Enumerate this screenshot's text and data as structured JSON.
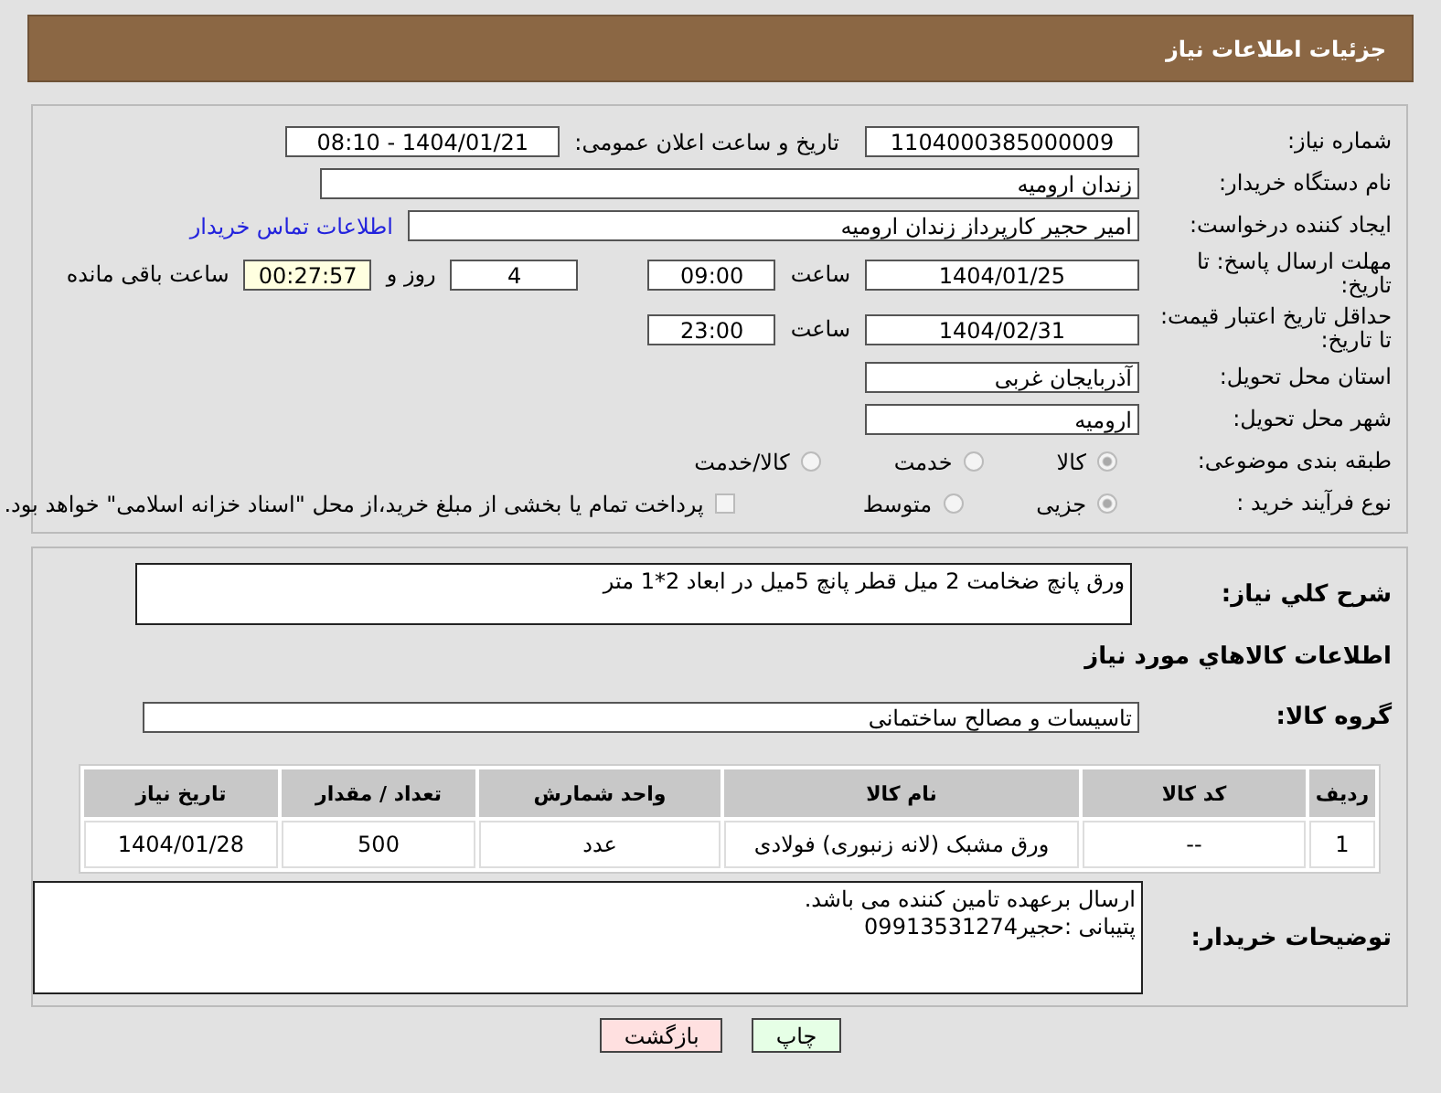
{
  "header": {
    "title": "جزئیات اطلاعات نیاز"
  },
  "need_number": {
    "label": "شماره نیاز:",
    "value": "1104000385000009"
  },
  "announce": {
    "label": "تاریخ و ساعت اعلان عمومی:",
    "value": "1404/01/21 - 08:10"
  },
  "buyer_org": {
    "label": "نام دستگاه خریدار:",
    "value": "زندان ارومیه"
  },
  "creator": {
    "label": "ایجاد کننده درخواست:",
    "value": "امیر حجیر کارپرداز زندان ارومیه",
    "link": "اطلاعات تماس خریدار"
  },
  "deadline": {
    "label": "مهلت ارسال پاسخ: تا تاریخ:",
    "date": "1404/01/25",
    "time_label": "ساعت",
    "time": "09:00",
    "days": "4",
    "days_label": "روز و",
    "remaining": "00:27:57",
    "remaining_label": "ساعت باقی مانده"
  },
  "validity": {
    "label": "حداقل تاریخ اعتبار قیمت: تا تاریخ:",
    "date": "1404/02/31",
    "time_label": "ساعت",
    "time": "23:00"
  },
  "province": {
    "label": "استان محل تحویل:",
    "value": "آذربایجان غربی"
  },
  "city": {
    "label": "شهر محل تحویل:",
    "value": "ارومیه"
  },
  "category": {
    "label": "طبقه بندی موضوعی:",
    "options": [
      {
        "label": "کالا",
        "selected": true
      },
      {
        "label": "خدمت",
        "selected": false
      },
      {
        "label": "کالا/خدمت",
        "selected": false
      }
    ]
  },
  "process": {
    "label": "نوع فرآیند خرید :",
    "options": [
      {
        "label": "جزیی",
        "selected": true
      },
      {
        "label": "متوسط",
        "selected": false
      }
    ],
    "payment": {
      "label": "پرداخت تمام یا بخشی از مبلغ خرید،از محل \"اسناد خزانه اسلامی\" خواهد بود.",
      "checked": false
    }
  },
  "description": {
    "label": "شرح کلي نیاز:",
    "value": "ورق پانچ ضخامت 2 میل قطر پانچ 5میل در ابعاد 2*1 متر"
  },
  "goods_heading": "اطلاعات کالاهاي مورد نیاز",
  "goods_group": {
    "label": "گروه کالا:",
    "value": "تاسیسات و مصالح ساختمانی"
  },
  "table": {
    "columns": [
      "ردیف",
      "کد کالا",
      "نام کالا",
      "واحد شمارش",
      "تعداد / مقدار",
      "تاریخ نیاز"
    ],
    "rows": [
      [
        "1",
        "--",
        "ورق مشبک (لانه زنبوری) فولادی",
        "عدد",
        "500",
        "1404/01/28"
      ]
    ]
  },
  "buyer_notes": {
    "label": "توضیحات خریدار:",
    "lines": [
      "ارسال برعهده تامین کننده می باشد.",
      "پتیبانی :حجیر09913531274"
    ]
  },
  "buttons": [
    {
      "label": "چاپ",
      "kind": "print"
    },
    {
      "label": "بازگشت",
      "kind": "back"
    }
  ]
}
